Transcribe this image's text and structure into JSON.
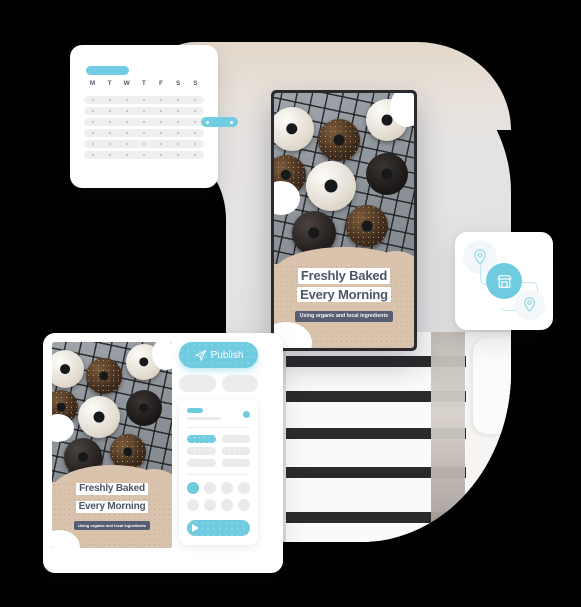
{
  "scene": {
    "title": "Social media scheduling app illustration",
    "accent_blue": "#6ecbe0",
    "accent_blue_light": "#bfe6f1",
    "tan": "#d9c3ad",
    "navy_text": "#4e5769",
    "badge_navy": "#555e72",
    "skeleton_gray": "#e9eaec",
    "card_white": "#ffffff",
    "blob_gray": "#e4e2e2"
  },
  "calendar_card": {
    "name": "Content calendar widget",
    "title_pill_label": "",
    "weekday_headers": [
      "M",
      "T",
      "W",
      "T",
      "F",
      "S",
      "S"
    ],
    "week_rows": 6,
    "selected_week_index": 2,
    "selected_range": "W - T"
  },
  "phone_preview": {
    "name": "Story preview on phone",
    "headline_line_1": "Freshly Baked",
    "headline_line_2": "Every Morning",
    "subtitle": "Using organic and local ingredients",
    "photo_alt": "Assorted donuts on a cooling rack"
  },
  "editor_card": {
    "name": "Post editor",
    "preview": {
      "headline_line_1": "Freshly Baked",
      "headline_line_2": "Every Morning",
      "subtitle": "Using organic and local ingredients",
      "photo_alt": "Assorted donuts on a cooling rack"
    },
    "publish_button": {
      "label": "Publish",
      "icon": "paper-plane-icon"
    },
    "ghost_buttons": [
      "",
      ""
    ],
    "panel": {
      "option_bars": [
        {
          "selected": true
        },
        {
          "selected": false
        },
        {
          "selected": false
        },
        {
          "selected": false
        },
        {
          "selected": false
        },
        {
          "selected": false
        }
      ],
      "color_swatches": [
        {
          "selected": true
        },
        {
          "selected": false
        },
        {
          "selected": false
        },
        {
          "selected": false
        },
        {
          "selected": false
        },
        {
          "selected": false
        },
        {
          "selected": false
        },
        {
          "selected": false
        }
      ],
      "play_bar_icon": "play-icon"
    }
  },
  "locations_card": {
    "name": "Multi-location publishing widget",
    "center_icon": "storefront-icon",
    "pins": [
      "location-pin-icon",
      "location-pin-icon"
    ]
  },
  "background": {
    "photo_alt": "White shelving with dark stripes and wooden crates"
  }
}
